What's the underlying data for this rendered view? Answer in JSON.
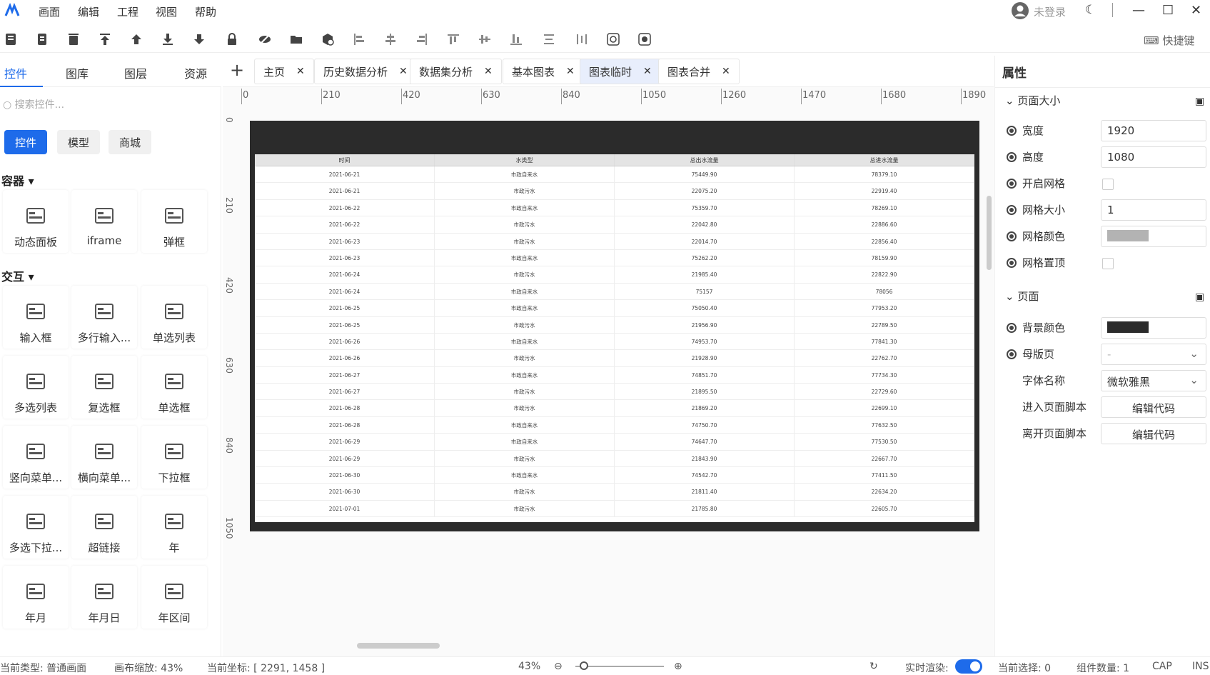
{
  "menu": [
    "画面",
    "编辑",
    "工程",
    "视图",
    "帮助"
  ],
  "user": {
    "login_label": "未登录"
  },
  "shortcut_label": "快捷键",
  "left_tabs": [
    "控件",
    "图库",
    "图层",
    "资源"
  ],
  "search_placeholder": "搜索控件...",
  "category_pills": [
    "控件",
    "模型",
    "商城"
  ],
  "sections": {
    "container": "容器",
    "interaction": "交互"
  },
  "container_items": [
    "动态面板",
    "iframe",
    "弹框"
  ],
  "interaction_items": [
    "输入框",
    "多行输入...",
    "单选列表",
    "多选列表",
    "复选框",
    "单选框",
    "竖向菜单...",
    "横向菜单...",
    "下拉框",
    "多选下拉...",
    "超链接",
    "年",
    "年月",
    "年月日",
    "年区间"
  ],
  "doc_tabs": [
    "主页",
    "历史数据分析",
    "数据集分析",
    "基本图表",
    "图表临时",
    "图表合并"
  ],
  "active_doc_tab": 4,
  "ruler_h": [
    "0",
    "210",
    "420",
    "630",
    "840",
    "1050",
    "1260",
    "1470",
    "1680",
    "1890"
  ],
  "ruler_v": [
    "0",
    "210",
    "420",
    "630",
    "840",
    "1050"
  ],
  "table": {
    "headers": [
      "时间",
      "水类型",
      "总出水流量",
      "总进水流量"
    ],
    "rows": [
      [
        "2021-06-21",
        "市政自来水",
        "75449.90",
        "78379.10"
      ],
      [
        "2021-06-21",
        "市政污水",
        "22075.20",
        "22919.40"
      ],
      [
        "2021-06-22",
        "市政自来水",
        "75359.70",
        "78269.10"
      ],
      [
        "2021-06-22",
        "市政污水",
        "22042.80",
        "22886.60"
      ],
      [
        "2021-06-23",
        "市政污水",
        "22014.70",
        "22856.40"
      ],
      [
        "2021-06-23",
        "市政自来水",
        "75262.20",
        "78159.90"
      ],
      [
        "2021-06-24",
        "市政污水",
        "21985.40",
        "22822.90"
      ],
      [
        "2021-06-24",
        "市政自来水",
        "75157",
        "78056"
      ],
      [
        "2021-06-25",
        "市政自来水",
        "75050.40",
        "77953.20"
      ],
      [
        "2021-06-25",
        "市政污水",
        "21956.90",
        "22789.50"
      ],
      [
        "2021-06-26",
        "市政自来水",
        "74953.70",
        "77841.30"
      ],
      [
        "2021-06-26",
        "市政污水",
        "21928.90",
        "22762.70"
      ],
      [
        "2021-06-27",
        "市政自来水",
        "74851.70",
        "77734.30"
      ],
      [
        "2021-06-27",
        "市政污水",
        "21895.50",
        "22729.60"
      ],
      [
        "2021-06-28",
        "市政污水",
        "21869.20",
        "22699.10"
      ],
      [
        "2021-06-28",
        "市政自来水",
        "74750.70",
        "77632.50"
      ],
      [
        "2021-06-29",
        "市政自来水",
        "74647.70",
        "77530.50"
      ],
      [
        "2021-06-29",
        "市政污水",
        "21843.90",
        "22667.70"
      ],
      [
        "2021-06-30",
        "市政自来水",
        "74542.70",
        "77411.50"
      ],
      [
        "2021-06-30",
        "市政污水",
        "21811.40",
        "22634.20"
      ],
      [
        "2021-07-01",
        "市政污水",
        "21785.80",
        "22605.70"
      ]
    ]
  },
  "props": {
    "title": "属性",
    "page_size_section": "页面大小",
    "width_label": "宽度",
    "width_value": "1920",
    "height_label": "高度",
    "height_value": "1080",
    "grid_on_label": "开启网格",
    "grid_size_label": "网格大小",
    "grid_size_value": "1",
    "grid_color_label": "网格颜色",
    "grid_color": "#b3b3b3",
    "grid_top_label": "网格置顶",
    "page_section": "页面",
    "bg_color_label": "背景颜色",
    "bg_color": "#2b2b2b",
    "master_label": "母版页",
    "master_value": "-",
    "font_label": "字体名称",
    "font_value": "微软雅黑",
    "enter_script_label": "进入页面脚本",
    "enter_script_btn": "编辑代码",
    "leave_script_label": "离开页面脚本",
    "leave_script_btn": "编辑代码"
  },
  "status": {
    "type": "当前类型: 普通画面",
    "zoom_text": "画布缩放: 43%",
    "coords": "当前坐标: [ 2291, 1458 ]",
    "zoom_value": "43%",
    "realtime_label": "实时渲染:",
    "selected": "当前选择: 0",
    "count": "组件数量: 1",
    "cap": "CAP",
    "ins": "INS"
  },
  "colors": {
    "accent": "#1e6bea",
    "page_bg": "#2b2b2b"
  }
}
